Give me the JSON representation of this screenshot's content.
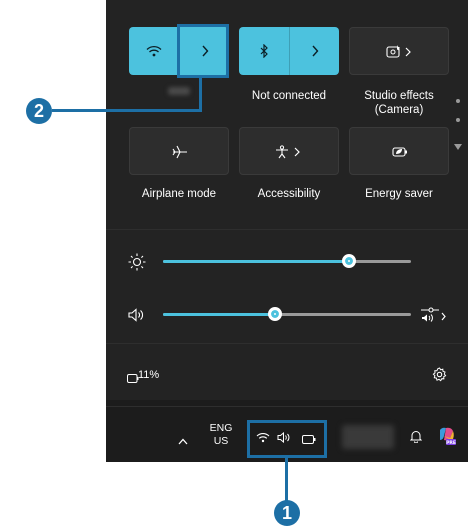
{
  "quick_settings": {
    "wifi": {
      "label": "",
      "state": "on"
    },
    "bluetooth": {
      "label": "Not connected",
      "state": "on"
    },
    "studio_effects": {
      "label_line1": "Studio effects",
      "label_line2": "(Camera)"
    },
    "airplane_mode": {
      "label": "Airplane mode"
    },
    "accessibility": {
      "label": "Accessibility"
    },
    "energy_saver": {
      "label": "Energy saver"
    }
  },
  "sliders": {
    "brightness": {
      "value_percent": 75
    },
    "volume": {
      "value_percent": 45
    }
  },
  "battery": {
    "percent_label": "11%"
  },
  "taskbar": {
    "language": "ENG",
    "region": "US"
  },
  "callouts": {
    "first": "1",
    "second": "2"
  },
  "colors": {
    "accent": "#4cc2de",
    "callout": "#1d6fa5",
    "panel_bg": "#232323",
    "taskbar_bg": "#1c1c1c"
  }
}
